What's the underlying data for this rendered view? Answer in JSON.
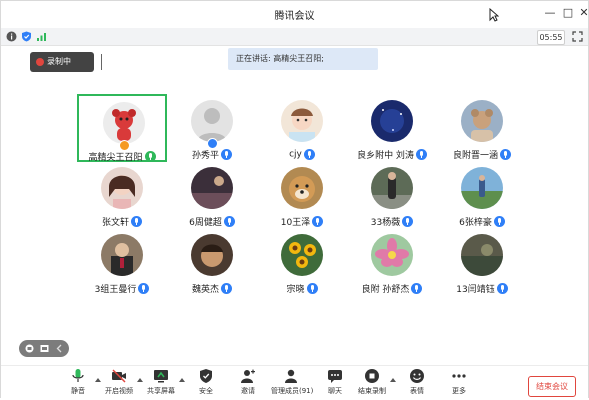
{
  "window": {
    "title": "腾讯会议",
    "minimize": "—",
    "maximize": "□",
    "close": "✕"
  },
  "infobar": {
    "time": "05:55"
  },
  "recording": {
    "label": "录制中"
  },
  "speaking": {
    "text": "正在讲话: 高精尖王召阳;"
  },
  "participants": [
    {
      "name": "高精尖王召阳",
      "active": true,
      "mic_color": "#2fb85a"
    },
    {
      "name": "孙秀平"
    },
    {
      "name": "cjy"
    },
    {
      "name": "良乡附中 刘涛"
    },
    {
      "name": "良附晋一涵"
    },
    {
      "name": "张文轩"
    },
    {
      "name": "6周健超"
    },
    {
      "name": "10王泽"
    },
    {
      "name": "33杨薇"
    },
    {
      "name": "6张梓豪"
    },
    {
      "name": "3组王曼行"
    },
    {
      "name": "魏英杰"
    },
    {
      "name": "宗晓"
    },
    {
      "name": "良附  孙舒杰"
    },
    {
      "name": "13闫靖钰"
    }
  ],
  "toolbar": {
    "mute": "静音",
    "video": "开启视频",
    "share": "共享屏幕",
    "security": "安全",
    "invite": "邀请",
    "members": "管理成员(91)",
    "chat": "聊天",
    "stop_record": "结束录制",
    "reaction": "表情",
    "more": "更多",
    "end_meeting": "结束会议"
  },
  "colors": {
    "accent": "#2f7ff7",
    "active_border": "#2fb85a",
    "danger": "#e0463e"
  }
}
